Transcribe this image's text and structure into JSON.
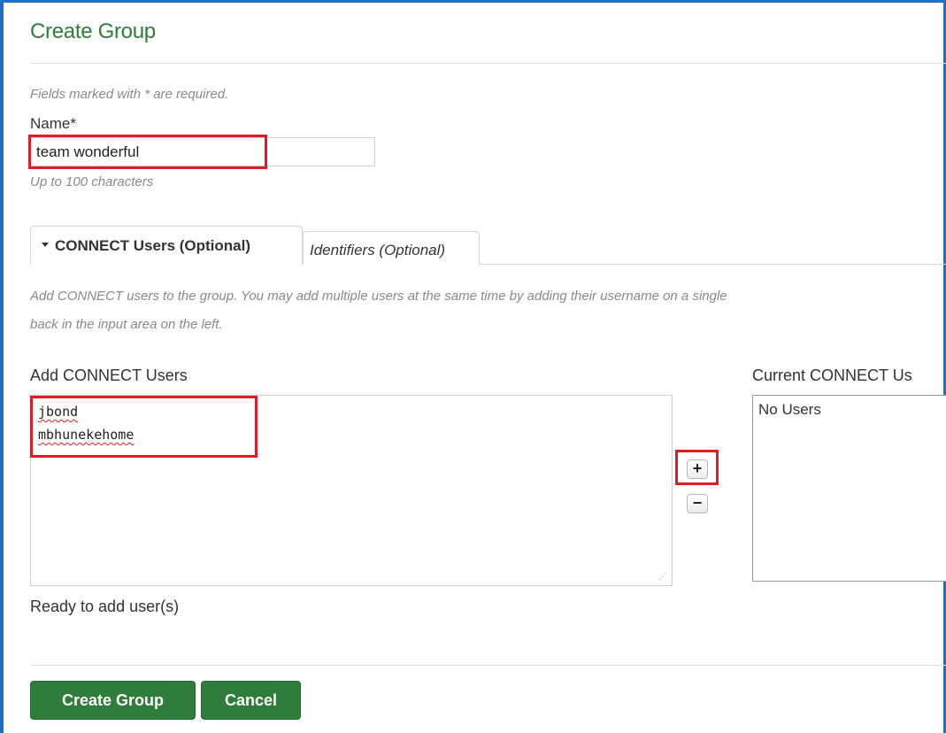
{
  "page": {
    "title": "Create Group",
    "required_hint": "Fields marked with * are required."
  },
  "name_field": {
    "label": "Name*",
    "value": "team wonderful",
    "help": "Up to 100 characters"
  },
  "tabs": [
    {
      "label": "CONNECT Users (Optional)",
      "active": true
    },
    {
      "label": "Identifiers (Optional)",
      "active": false
    }
  ],
  "connect_users": {
    "description_line1": "Add CONNECT users to the group. You may add multiple users at the same time by adding their username on a single",
    "description_line2": "back in the input area on the left.",
    "add_label": "Add CONNECT Users",
    "entered_users": [
      "jbond",
      "mbhunekehome"
    ],
    "current_label": "Current CONNECT Us",
    "current_value": "No Users",
    "add_symbol": "+",
    "remove_symbol": "−",
    "status": "Ready to add user(s)"
  },
  "actions": {
    "create_label": "Create Group",
    "cancel_label": "Cancel"
  },
  "colors": {
    "title_green": "#2e7d3a",
    "button_green": "#2e7d3a",
    "highlight_red": "#e31b23",
    "frame_blue": "#1f6fc5"
  }
}
